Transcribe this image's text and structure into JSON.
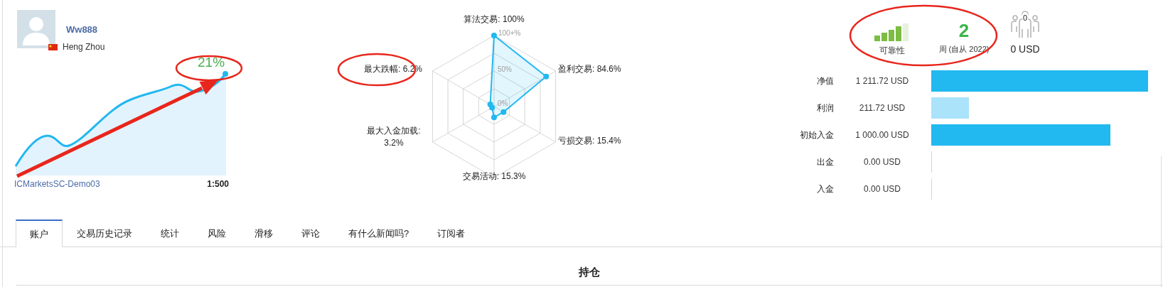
{
  "profile": {
    "name": "Ww888",
    "location": "Heng Zhou"
  },
  "growth": {
    "value": "21%"
  },
  "account": {
    "server": "ICMarketsSC-Demo03",
    "leverage": "1:500"
  },
  "radar": {
    "grid_labels": [
      "100+%",
      "50%",
      "0%"
    ],
    "axes": [
      {
        "label": "算法交易: 100%"
      },
      {
        "label": "最大跌幅: 6.2%"
      },
      {
        "label": "盈利交易: 84.6%"
      },
      {
        "label": "最大入金加载: 3.2%"
      },
      {
        "label": "亏损交易: 15.4%"
      },
      {
        "label": "交易活动: 15.3%"
      }
    ]
  },
  "reliability": {
    "label": "可靠性"
  },
  "weeks": {
    "value": "2",
    "label": "周 (自从 2022)"
  },
  "subscribers": {
    "count": "0",
    "funds": "0 USD"
  },
  "balances": [
    {
      "label": "净值",
      "value": "1 211.72 USD",
      "color": "#22b8f0"
    },
    {
      "label": "利润",
      "value": "211.72 USD",
      "color": "#aae3fa"
    },
    {
      "label": "初始入金",
      "value": "1 000.00 USD",
      "color": "#22b8f0"
    },
    {
      "label": "出金",
      "value": "0.00 USD",
      "color": "#aae3fa"
    },
    {
      "label": "入金",
      "value": "0.00 USD",
      "color": "#aae3fa"
    }
  ],
  "tabs": [
    {
      "label": "账户",
      "selected": true
    },
    {
      "label": "交易历史记录",
      "selected": false
    },
    {
      "label": "统计",
      "selected": false
    },
    {
      "label": "风险",
      "selected": false
    },
    {
      "label": "滑移",
      "selected": false
    },
    {
      "label": "评论",
      "selected": false
    },
    {
      "label": "有什么新闻吗?",
      "selected": false
    },
    {
      "label": "订阅者",
      "selected": false
    }
  ],
  "section_title": "持仓"
}
